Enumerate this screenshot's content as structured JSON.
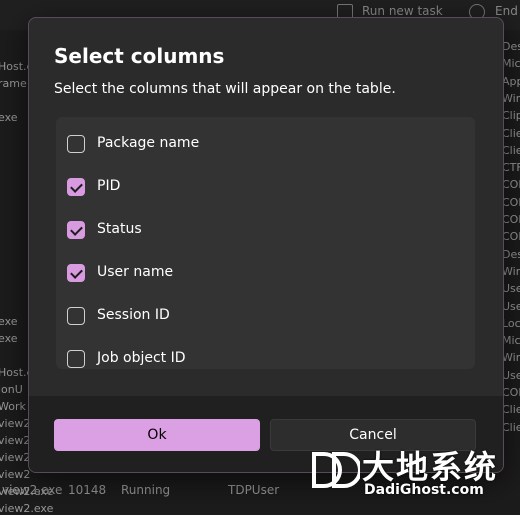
{
  "toolbar": {
    "run_new_task": "Run new task",
    "end_task": "End"
  },
  "background_left": [
    "Host.e",
    "rame",
    "",
    "exe",
    "",
    "",
    "",
    "",
    "",
    "",
    "",
    "",
    "",
    "",
    "",
    "exe",
    "exe",
    "",
    "Host.e",
    "ionU",
    "Work",
    "view2",
    "view2",
    "view2",
    "view2",
    "view2.exe",
    "view2.exe"
  ],
  "background_right": [
    "Des",
    "Mic",
    "App",
    "Win",
    "Clip",
    "Clie",
    "Clie",
    "CTF",
    "COI",
    "COI",
    "COI",
    "COI",
    "Des",
    "Win",
    "Use",
    "Use",
    "Loc",
    "Mic",
    "Win",
    "Use",
    "COI",
    "Clie",
    "Clie"
  ],
  "background_rows": [
    {
      "name": "view2.exe",
      "pid": "10148",
      "status": "Running",
      "user": "TDPUser"
    }
  ],
  "dialog": {
    "title": "Select columns",
    "subtitle": "Select the columns that will appear on the table.",
    "items": [
      {
        "label": "Package name",
        "checked": false
      },
      {
        "label": "PID",
        "checked": true
      },
      {
        "label": "Status",
        "checked": true
      },
      {
        "label": "User name",
        "checked": true
      },
      {
        "label": "Session ID",
        "checked": false
      },
      {
        "label": "Job object ID",
        "checked": false
      }
    ],
    "ok_label": "Ok",
    "cancel_label": "Cancel"
  },
  "watermark": {
    "cn": "大地系统",
    "en": "DadiGhost.com"
  },
  "colors": {
    "accent": "#dba0e3",
    "dialog_bg": "#2b2b2b",
    "list_bg": "#333333",
    "footer_bg": "#202020"
  }
}
